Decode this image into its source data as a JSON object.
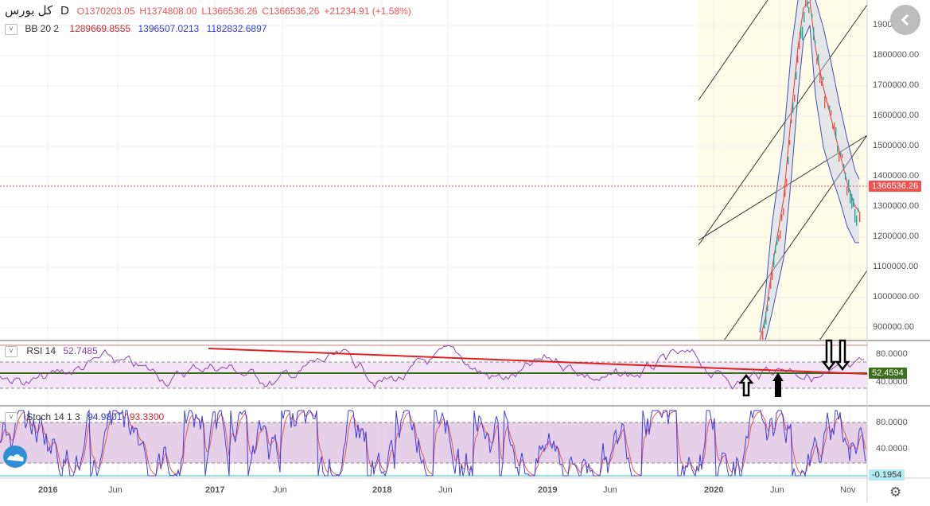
{
  "header": {
    "symbol": "کل بورس",
    "interval": "D",
    "open": "O1370203.05",
    "high": "H1374808.00",
    "low": "L1366536.26",
    "close": "C1366536.26",
    "change": "+21234.91 (+1.58%)"
  },
  "indicators": {
    "bb": {
      "label": "BB 20 2",
      "basis": "1289669.8555",
      "upper": "1396507.0213",
      "lower": "1182832.6897"
    },
    "rsi": {
      "label": "RSI 14",
      "value": "52.7485",
      "axis_tag": "52.4594"
    },
    "stoch": {
      "label": "Stoch 14 1 3",
      "k": "94.9801",
      "d": "93.3300",
      "axis_tag": "-0.1954"
    }
  },
  "price_axis": {
    "ticks": [
      "1900000.00",
      "1800000.00",
      "1700000.00",
      "1600000.00",
      "1500000.00",
      "1400000.00",
      "1300000.00",
      "1200000.00",
      "1100000.00",
      "1000000.00",
      "900000.00"
    ],
    "last_price_tag": "1366536.26"
  },
  "rsi_axis": {
    "ticks": [
      "80.0000",
      "40.0000"
    ]
  },
  "stoch_axis": {
    "ticks": [
      "80.0000",
      "40.0000"
    ]
  },
  "time_axis": {
    "labels": [
      "2016",
      "Jun",
      "2017",
      "Jun",
      "2018",
      "Jun",
      "2019",
      "Jun",
      "2020",
      "Jun",
      "Nov"
    ]
  },
  "colors": {
    "up": "#26a69a",
    "down": "#ef5350",
    "bb_basis": "#e53935",
    "bb_band": "#3f51b5",
    "rsi_line": "#8e44ad",
    "rsi_band": "#f3e5f5",
    "stoch_k": "#3f3fe0",
    "stoch_d": "#e05a5a",
    "stoch_band": "#dcc0e0",
    "trendline": "#e02020",
    "midline": "#3c6e1e",
    "highlight": "#fffde7",
    "last_price": "#ef5350"
  },
  "icons": {
    "back": "chevron-left-icon",
    "settings": "gear-icon",
    "logo": "tradingview-cloud-icon",
    "arrows_up": "arrow-up-icon",
    "arrows_down": "arrow-down-icon"
  }
}
